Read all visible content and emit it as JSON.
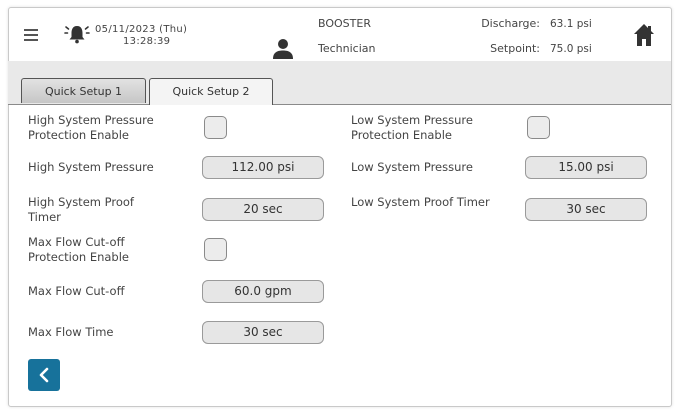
{
  "header": {
    "date": "05/11/2023 (Thu)",
    "time": "13:28:39",
    "mode": "BOOSTER",
    "role": "Technician",
    "discharge_label": "Discharge:",
    "discharge_value": "63.1 psi",
    "setpoint_label": "Setpoint:",
    "setpoint_value": "75.0 psi"
  },
  "tabs": [
    {
      "label": "Quick Setup 1",
      "active": false
    },
    {
      "label": "Quick Setup 2",
      "active": true
    }
  ],
  "settings": {
    "high_pressure_enable": {
      "label": "High System Pressure Protection Enable",
      "checked": false
    },
    "high_pressure": {
      "label": "High System Pressure",
      "value": "112.00 psi"
    },
    "high_proof_timer": {
      "label": "High System Proof Timer",
      "value": "20 sec"
    },
    "max_flow_enable": {
      "label": "Max Flow Cut-off Protection Enable",
      "checked": false
    },
    "max_flow_cutoff": {
      "label": "Max Flow Cut-off",
      "value": "60.0 gpm"
    },
    "max_flow_time": {
      "label": "Max Flow Time",
      "value": "30 sec"
    },
    "low_pressure_enable": {
      "label": "Low System Pressure Protection Enable",
      "checked": false
    },
    "low_pressure": {
      "label": "Low System Pressure",
      "value": "15.00 psi"
    },
    "low_proof_timer": {
      "label": "Low System Proof Timer",
      "value": "30 sec"
    }
  },
  "colors": {
    "back_button": "#17729b",
    "band": "#e9e9e9"
  },
  "icons": [
    "menu-icon",
    "alarm-bell-icon",
    "user-icon",
    "home-icon",
    "chevron-left-icon"
  ]
}
